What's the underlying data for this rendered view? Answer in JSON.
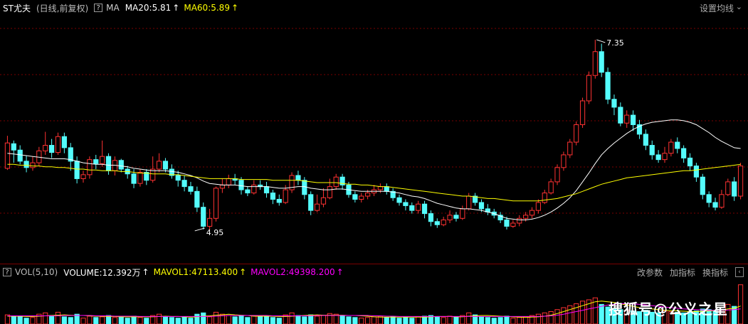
{
  "header": {
    "stock_name": "ST尤夫",
    "period": "(日线,前复权)",
    "ma_toggle_icon": "question-box-icon",
    "ma_label": "MA",
    "ma20_text": "MA20:5.81",
    "ma60_text": "MA60:5.89",
    "settings_label": "设置均线",
    "caret_icon": "chevron-down-icon"
  },
  "volume_header": {
    "indicator_label": "VOL(5,10)",
    "volume_text": "VOLUME:12.392万",
    "mavol1_text": "MAVOL1:47113.400",
    "mavol2_text": "MAVOL2:49398.200",
    "buttons": [
      "改参数",
      "加指标",
      "换指标"
    ]
  },
  "annotations": {
    "high": "7.35",
    "low": "4.95"
  },
  "watermark": "搜狐号@公义之星",
  "colors": {
    "up": "#ff3232",
    "down": "#54fcfc",
    "ma20": "#ffffff",
    "ma60": "#ffff00",
    "mavol2": "#ff00ff",
    "grid": "#7a0000"
  },
  "chart_data": {
    "type": "candlestick",
    "price_range": [
      4.7,
      7.6
    ],
    "candles": [
      [
        5.73,
        6.05,
        6.14,
        5.71
      ],
      [
        6.04,
        5.96,
        6.08,
        5.8
      ],
      [
        5.96,
        5.82,
        6.02,
        5.78
      ],
      [
        5.82,
        5.74,
        5.89,
        5.68
      ],
      [
        5.74,
        5.8,
        5.88,
        5.7
      ],
      [
        5.8,
        5.95,
        6.0,
        5.76
      ],
      [
        5.95,
        6.02,
        6.19,
        5.9
      ],
      [
        6.02,
        5.93,
        6.1,
        5.86
      ],
      [
        5.93,
        6.13,
        6.18,
        5.9
      ],
      [
        6.13,
        5.99,
        6.18,
        5.92
      ],
      [
        5.99,
        5.82,
        6.05,
        5.7
      ],
      [
        5.82,
        5.6,
        5.88,
        5.54
      ],
      [
        5.6,
        5.65,
        5.7,
        5.55
      ],
      [
        5.65,
        5.84,
        5.88,
        5.6
      ],
      [
        5.84,
        5.79,
        5.9,
        5.72
      ],
      [
        5.79,
        5.88,
        6.08,
        5.75
      ],
      [
        5.88,
        5.7,
        5.92,
        5.65
      ],
      [
        5.7,
        5.83,
        5.88,
        5.64
      ],
      [
        5.83,
        5.72,
        5.85,
        5.68
      ],
      [
        5.72,
        5.66,
        5.76,
        5.6
      ],
      [
        5.66,
        5.54,
        5.72,
        5.48
      ],
      [
        5.54,
        5.68,
        5.72,
        5.5
      ],
      [
        5.68,
        5.58,
        5.72,
        5.52
      ],
      [
        5.58,
        5.72,
        5.88,
        5.55
      ],
      [
        5.72,
        5.82,
        5.92,
        5.68
      ],
      [
        5.82,
        5.72,
        5.86,
        5.68
      ],
      [
        5.72,
        5.64,
        5.78,
        5.6
      ],
      [
        5.64,
        5.58,
        5.7,
        5.5
      ],
      [
        5.58,
        5.5,
        5.64,
        5.44
      ],
      [
        5.5,
        5.44,
        5.56,
        5.4
      ],
      [
        5.44,
        5.24,
        5.5,
        5.18
      ],
      [
        5.24,
        5.0,
        5.3,
        4.96
      ],
      [
        5.0,
        5.1,
        5.22,
        4.96
      ],
      [
        5.1,
        5.48,
        5.5,
        5.06
      ],
      [
        5.48,
        5.52,
        5.6,
        5.42
      ],
      [
        5.52,
        5.6,
        5.65,
        5.48
      ],
      [
        5.6,
        5.58,
        5.66,
        5.52
      ],
      [
        5.58,
        5.46,
        5.62,
        5.4
      ],
      [
        5.46,
        5.42,
        5.5,
        5.38
      ],
      [
        5.42,
        5.52,
        5.58,
        5.4
      ],
      [
        5.52,
        5.5,
        5.58,
        5.46
      ],
      [
        5.5,
        5.42,
        5.56,
        5.36
      ],
      [
        5.42,
        5.34,
        5.46,
        5.28
      ],
      [
        5.34,
        5.3,
        5.4,
        5.26
      ],
      [
        5.3,
        5.46,
        5.52,
        5.28
      ],
      [
        5.46,
        5.64,
        5.68,
        5.42
      ],
      [
        5.64,
        5.58,
        5.7,
        5.52
      ],
      [
        5.58,
        5.4,
        5.62,
        5.34
      ],
      [
        5.4,
        5.2,
        5.44,
        5.14
      ],
      [
        5.2,
        5.28,
        5.4,
        5.18
      ],
      [
        5.28,
        5.36,
        5.48,
        5.24
      ],
      [
        5.36,
        5.5,
        5.6,
        5.34
      ],
      [
        5.5,
        5.62,
        5.66,
        5.46
      ],
      [
        5.62,
        5.52,
        5.66,
        5.46
      ],
      [
        5.52,
        5.4,
        5.56,
        5.36
      ],
      [
        5.4,
        5.34,
        5.44,
        5.3
      ],
      [
        5.34,
        5.38,
        5.42,
        5.3
      ],
      [
        5.38,
        5.42,
        5.46,
        5.34
      ],
      [
        5.42,
        5.46,
        5.52,
        5.38
      ],
      [
        5.46,
        5.5,
        5.54,
        5.42
      ],
      [
        5.5,
        5.44,
        5.54,
        5.4
      ],
      [
        5.44,
        5.36,
        5.48,
        5.32
      ],
      [
        5.36,
        5.3,
        5.4,
        5.26
      ],
      [
        5.3,
        5.26,
        5.34,
        5.2
      ],
      [
        5.26,
        5.2,
        5.3,
        5.16
      ],
      [
        5.2,
        5.28,
        5.32,
        5.16
      ],
      [
        5.28,
        5.16,
        5.32,
        5.1
      ],
      [
        5.16,
        5.06,
        5.2,
        5.0
      ],
      [
        5.06,
        5.02,
        5.1,
        4.98
      ],
      [
        5.02,
        5.08,
        5.12,
        5.0
      ],
      [
        5.08,
        5.14,
        5.2,
        5.04
      ],
      [
        5.14,
        5.1,
        5.18,
        5.06
      ],
      [
        5.1,
        5.22,
        5.26,
        5.08
      ],
      [
        5.22,
        5.38,
        5.42,
        5.2
      ],
      [
        5.38,
        5.3,
        5.42,
        5.26
      ],
      [
        5.3,
        5.22,
        5.34,
        5.18
      ],
      [
        5.22,
        5.18,
        5.28,
        5.14
      ],
      [
        5.18,
        5.14,
        5.22,
        5.1
      ],
      [
        5.14,
        5.08,
        5.18,
        5.04
      ],
      [
        5.08,
        5.0,
        5.12,
        4.96
      ],
      [
        5.0,
        5.04,
        5.08,
        4.98
      ],
      [
        5.04,
        5.1,
        5.14,
        5.0
      ],
      [
        5.1,
        5.14,
        5.18,
        5.06
      ],
      [
        5.14,
        5.2,
        5.24,
        5.1
      ],
      [
        5.2,
        5.3,
        5.34,
        5.16
      ],
      [
        5.3,
        5.42,
        5.46,
        5.28
      ],
      [
        5.42,
        5.56,
        5.6,
        5.4
      ],
      [
        5.56,
        5.74,
        5.78,
        5.52
      ],
      [
        5.74,
        5.9,
        5.94,
        5.7
      ],
      [
        5.9,
        6.06,
        6.1,
        5.86
      ],
      [
        6.06,
        6.28,
        6.32,
        6.02
      ],
      [
        6.28,
        6.58,
        6.62,
        6.24
      ],
      [
        6.58,
        6.9,
        6.95,
        6.54
      ],
      [
        6.9,
        7.2,
        7.35,
        6.86
      ],
      [
        7.2,
        6.94,
        7.3,
        6.88
      ],
      [
        6.94,
        6.6,
        7.0,
        6.54
      ],
      [
        6.6,
        6.5,
        6.66,
        6.4
      ],
      [
        6.5,
        6.3,
        6.56,
        6.26
      ],
      [
        6.3,
        6.4,
        6.46,
        6.24
      ],
      [
        6.4,
        6.28,
        6.46,
        6.2
      ],
      [
        6.28,
        6.16,
        6.34,
        6.1
      ],
      [
        6.16,
        6.02,
        6.22,
        5.96
      ],
      [
        6.02,
        5.9,
        6.08,
        5.84
      ],
      [
        5.9,
        5.84,
        5.96,
        5.8
      ],
      [
        5.84,
        5.92,
        6.0,
        5.8
      ],
      [
        5.92,
        6.06,
        6.1,
        5.88
      ],
      [
        6.06,
        5.98,
        6.12,
        5.92
      ],
      [
        5.98,
        5.86,
        6.02,
        5.8
      ],
      [
        5.86,
        5.76,
        5.92,
        5.7
      ],
      [
        5.76,
        5.62,
        5.8,
        5.56
      ],
      [
        5.62,
        5.4,
        5.66,
        5.34
      ],
      [
        5.4,
        5.3,
        5.44,
        5.24
      ],
      [
        5.3,
        5.24,
        5.36,
        5.2
      ],
      [
        5.24,
        5.4,
        5.46,
        5.22
      ],
      [
        5.4,
        5.56,
        5.6,
        5.38
      ],
      [
        5.56,
        5.38,
        5.62,
        5.32
      ],
      [
        5.38,
        5.76,
        5.8,
        5.34
      ]
    ],
    "ma20": [
      5.92,
      5.91,
      5.9,
      5.89,
      5.88,
      5.87,
      5.86,
      5.85,
      5.85,
      5.85,
      5.84,
      5.82,
      5.8,
      5.79,
      5.78,
      5.78,
      5.77,
      5.77,
      5.76,
      5.75,
      5.73,
      5.72,
      5.71,
      5.7,
      5.7,
      5.7,
      5.69,
      5.68,
      5.66,
      5.64,
      5.61,
      5.57,
      5.54,
      5.53,
      5.52,
      5.52,
      5.52,
      5.51,
      5.5,
      5.5,
      5.5,
      5.5,
      5.49,
      5.48,
      5.48,
      5.49,
      5.5,
      5.5,
      5.48,
      5.47,
      5.46,
      5.46,
      5.47,
      5.47,
      5.46,
      5.45,
      5.44,
      5.44,
      5.44,
      5.44,
      5.44,
      5.43,
      5.42,
      5.4,
      5.38,
      5.37,
      5.35,
      5.32,
      5.29,
      5.27,
      5.25,
      5.23,
      5.22,
      5.22,
      5.21,
      5.2,
      5.18,
      5.16,
      5.13,
      5.1,
      5.09,
      5.08,
      5.08,
      5.09,
      5.11,
      5.14,
      5.18,
      5.23,
      5.29,
      5.36,
      5.45,
      5.56,
      5.67,
      5.79,
      5.9,
      5.98,
      6.05,
      6.11,
      6.17,
      6.22,
      6.26,
      6.29,
      6.31,
      6.32,
      6.33,
      6.34,
      6.34,
      6.33,
      6.31,
      6.28,
      6.23,
      6.18,
      6.12,
      6.07,
      6.03,
      5.99,
      5.98
    ],
    "ma60": [
      5.78,
      5.78,
      5.77,
      5.77,
      5.76,
      5.76,
      5.75,
      5.75,
      5.74,
      5.74,
      5.73,
      5.72,
      5.72,
      5.71,
      5.71,
      5.7,
      5.7,
      5.7,
      5.69,
      5.69,
      5.68,
      5.67,
      5.67,
      5.66,
      5.66,
      5.66,
      5.65,
      5.65,
      5.64,
      5.63,
      5.62,
      5.61,
      5.6,
      5.6,
      5.6,
      5.6,
      5.6,
      5.59,
      5.59,
      5.59,
      5.59,
      5.59,
      5.58,
      5.58,
      5.58,
      5.58,
      5.58,
      5.57,
      5.56,
      5.55,
      5.55,
      5.55,
      5.55,
      5.54,
      5.53,
      5.53,
      5.52,
      5.52,
      5.51,
      5.5,
      5.5,
      5.49,
      5.48,
      5.47,
      5.46,
      5.45,
      5.44,
      5.43,
      5.42,
      5.41,
      5.4,
      5.39,
      5.38,
      5.38,
      5.37,
      5.36,
      5.35,
      5.35,
      5.34,
      5.33,
      5.32,
      5.32,
      5.32,
      5.32,
      5.32,
      5.33,
      5.34,
      5.35,
      5.37,
      5.39,
      5.41,
      5.44,
      5.47,
      5.5,
      5.53,
      5.55,
      5.57,
      5.59,
      5.61,
      5.62,
      5.63,
      5.64,
      5.65,
      5.66,
      5.67,
      5.68,
      5.69,
      5.7,
      5.7,
      5.71,
      5.72,
      5.73,
      5.74,
      5.75,
      5.76,
      5.77,
      5.78
    ],
    "volume": [
      28,
      22,
      24,
      18,
      20,
      30,
      34,
      26,
      36,
      22,
      20,
      30,
      18,
      24,
      20,
      22,
      26,
      20,
      22,
      18,
      24,
      20,
      18,
      26,
      30,
      22,
      20,
      18,
      22,
      18,
      30,
      34,
      22,
      36,
      30,
      26,
      22,
      24,
      20,
      26,
      22,
      24,
      20,
      18,
      28,
      34,
      26,
      22,
      28,
      24,
      26,
      32,
      30,
      24,
      22,
      20,
      18,
      20,
      22,
      24,
      20,
      22,
      18,
      20,
      18,
      22,
      24,
      26,
      22,
      20,
      24,
      22,
      26,
      34,
      28,
      22,
      20,
      18,
      20,
      24,
      18,
      20,
      22,
      26,
      30,
      34,
      38,
      44,
      50,
      56,
      62,
      70,
      74,
      80,
      60,
      52,
      48,
      44,
      42,
      40,
      38,
      42,
      36,
      34,
      40,
      38,
      36,
      34,
      38,
      40,
      46,
      44,
      40,
      42,
      60,
      54,
      120
    ],
    "mavol1": [
      24,
      24,
      24,
      23,
      23,
      24,
      25,
      26,
      27,
      28,
      27,
      26,
      26,
      25,
      24,
      24,
      23,
      23,
      22,
      22,
      22,
      22,
      22,
      22,
      23,
      24,
      23,
      23,
      22,
      21,
      22,
      24,
      25,
      27,
      28,
      30,
      28,
      27,
      26,
      24,
      24,
      24,
      24,
      23,
      23,
      24,
      25,
      26,
      27,
      28,
      27,
      27,
      27,
      27,
      26,
      26,
      25,
      24,
      22,
      21,
      21,
      21,
      21,
      21,
      21,
      21,
      21,
      22,
      23,
      23,
      23,
      22,
      22,
      24,
      25,
      26,
      26,
      25,
      24,
      23,
      22,
      21,
      20,
      21,
      22,
      24,
      27,
      32,
      38,
      44,
      50,
      56,
      62,
      68,
      70,
      68,
      66,
      62,
      58,
      54,
      50,
      48,
      46,
      44,
      42,
      41,
      40,
      39,
      38,
      38,
      39,
      40,
      41,
      42,
      46,
      48,
      55
    ],
    "mavol2": [
      25,
      25,
      25,
      25,
      25,
      25,
      25,
      25,
      25,
      26,
      26,
      26,
      26,
      26,
      25,
      25,
      25,
      24,
      24,
      24,
      24,
      23,
      23,
      23,
      23,
      23,
      23,
      23,
      23,
      23,
      23,
      23,
      23,
      24,
      25,
      26,
      26,
      26,
      26,
      26,
      26,
      26,
      25,
      25,
      25,
      25,
      25,
      25,
      25,
      26,
      26,
      26,
      26,
      26,
      26,
      26,
      26,
      26,
      25,
      25,
      24,
      24,
      23,
      23,
      23,
      23,
      23,
      23,
      23,
      23,
      23,
      23,
      23,
      23,
      23,
      23,
      23,
      23,
      23,
      23,
      23,
      23,
      23,
      23,
      23,
      24,
      25,
      27,
      30,
      34,
      38,
      42,
      46,
      50,
      54,
      58,
      60,
      62,
      62,
      61,
      60,
      58,
      56,
      54,
      52,
      50,
      48,
      46,
      45,
      44,
      43,
      42,
      42,
      42,
      43,
      44,
      46
    ]
  }
}
